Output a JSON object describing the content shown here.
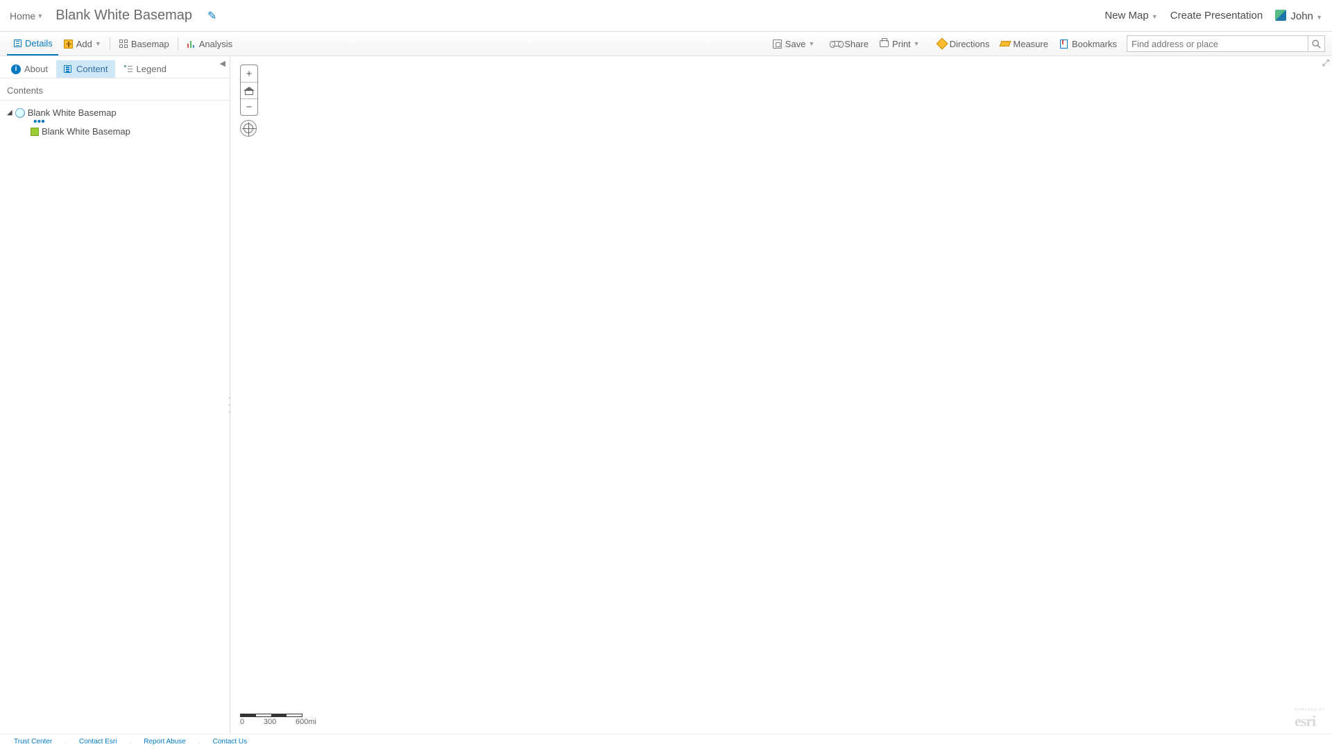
{
  "header": {
    "home": "Home",
    "title": "Blank White Basemap",
    "new_map": "New Map",
    "create_presentation": "Create Presentation",
    "user": "John"
  },
  "toolbar": {
    "details": "Details",
    "add": "Add",
    "basemap": "Basemap",
    "analysis": "Analysis",
    "save": "Save",
    "share": "Share",
    "print": "Print",
    "directions": "Directions",
    "measure": "Measure",
    "bookmarks": "Bookmarks",
    "search_placeholder": "Find address or place"
  },
  "side_tabs": {
    "about": "About",
    "content": "Content",
    "legend": "Legend"
  },
  "panel": {
    "contents_header": "Contents",
    "root_layer": "Blank White Basemap",
    "child_layer": "Blank White Basemap"
  },
  "scale": {
    "s0": "0",
    "s1": "300",
    "s2": "600mi"
  },
  "logo": {
    "text": "esri",
    "tag": "POWERED BY"
  },
  "footer": {
    "trust": "Trust Center",
    "contact_esri": "Contact Esri",
    "report": "Report Abuse",
    "contact_us": "Contact Us"
  }
}
